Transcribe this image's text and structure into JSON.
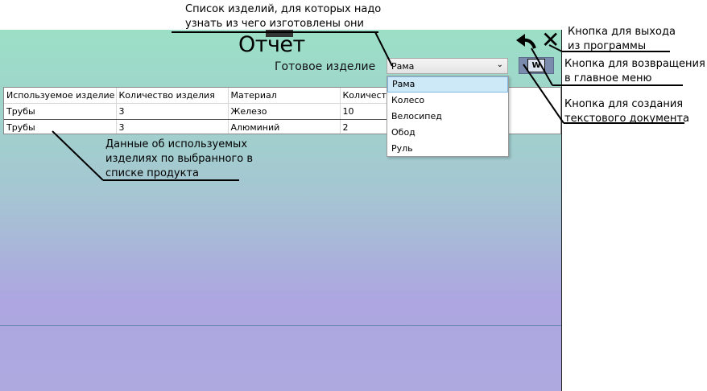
{
  "window": {
    "title": "Отчет",
    "product_label": "Готовое изделие",
    "combo": {
      "selected": "Рама",
      "arrow": "⌄"
    },
    "dropdown_items": [
      "Рама",
      "Колесо",
      "Велосипед",
      "Обод",
      "Руль"
    ],
    "word_button_icon": "W",
    "table": {
      "headers": [
        "Используемое изделие",
        "Количество изделия",
        "Материал",
        "Количество"
      ],
      "rows": [
        [
          "Трубы",
          "3",
          "Железо",
          "10"
        ],
        [
          "Трубы",
          "3",
          "Алюминий",
          "2"
        ]
      ]
    }
  },
  "annotations": {
    "product_list": [
      "Список изделий, для которых надо",
      "узнать из чего изготовлены они"
    ],
    "exit_button": [
      "Кнопка для выхода",
      "из программы"
    ],
    "back_button": [
      "Кнопка для возвращения",
      "в главное меню"
    ],
    "doc_button": [
      "Кнопка для создания",
      "текстового документа"
    ],
    "table_data": [
      "Данные об используемых",
      "изделиях по выбранного в",
      "списке продукта"
    ]
  },
  "icons": {
    "close": "close-icon",
    "back": "back-arrow-icon",
    "word": "word-document-icon"
  }
}
